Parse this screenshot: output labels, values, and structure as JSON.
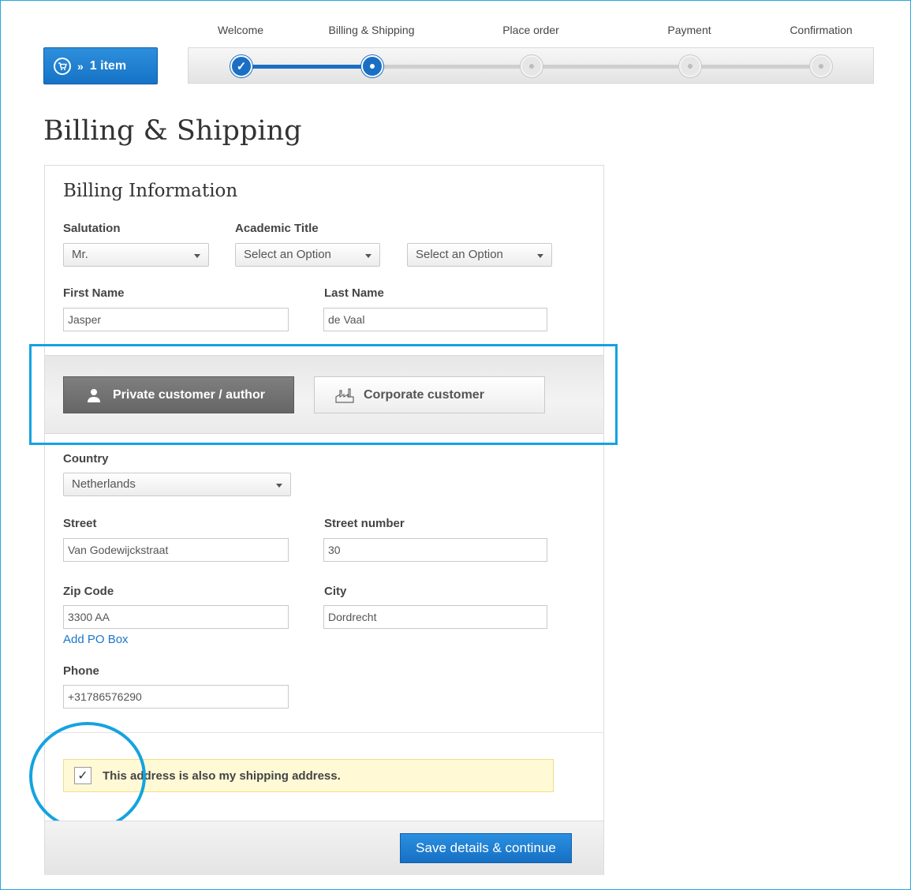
{
  "cart": {
    "count_label": "1 item",
    "separator": "»"
  },
  "steps": [
    {
      "label": "Welcome",
      "state": "done"
    },
    {
      "label": "Billing & Shipping",
      "state": "current"
    },
    {
      "label": "Place order",
      "state": "todo"
    },
    {
      "label": "Payment",
      "state": "todo"
    },
    {
      "label": "Confirmation",
      "state": "todo"
    }
  ],
  "page_title": "Billing & Shipping",
  "billing": {
    "section_title": "Billing Information",
    "salutation": {
      "label": "Salutation",
      "value": "Mr."
    },
    "academic_title": {
      "label": "Academic Title",
      "value1": "Select an Option",
      "value2": "Select an Option"
    },
    "first_name": {
      "label": "First Name",
      "value": "Jasper"
    },
    "last_name": {
      "label": "Last Name",
      "value": "de Vaal"
    }
  },
  "customer_type": {
    "private_label": "Private customer / author",
    "corporate_label": "Corporate customer",
    "selected": "private"
  },
  "address": {
    "country": {
      "label": "Country",
      "value": "Netherlands"
    },
    "street": {
      "label": "Street",
      "value": "Van Godewijckstraat"
    },
    "street_number": {
      "label": "Street number",
      "value": "30"
    },
    "zip": {
      "label": "Zip Code",
      "value": "3300 AA"
    },
    "city": {
      "label": "City",
      "value": "Dordrecht"
    },
    "po_box_link": "Add PO Box",
    "phone": {
      "label": "Phone",
      "value": "+31786576290"
    }
  },
  "shipping": {
    "checkbox_label": "This address is also my shipping address.",
    "checked": true
  },
  "actions": {
    "save_label": "Save details & continue"
  },
  "colors": {
    "accent": "#1a6fc4",
    "highlight": "#14a3e0",
    "notice_bg": "#fff9d6"
  }
}
